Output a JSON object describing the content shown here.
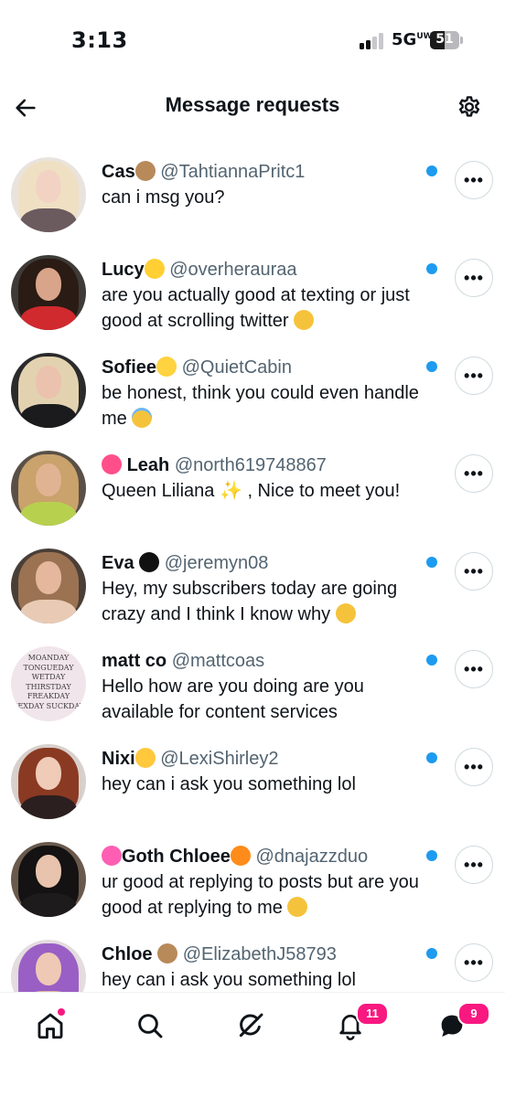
{
  "status_bar": {
    "time": "3:13",
    "network": "5G",
    "network_sup": "UW",
    "battery_level": "51",
    "battery_fraction": 0.51
  },
  "header": {
    "title": "Message requests"
  },
  "colors": {
    "accent": "#1d9bf0",
    "badge": "#f91880",
    "handle": "#536471",
    "text": "#0f1419",
    "border": "#cfd9de"
  },
  "requests": [
    {
      "display_name": "Cas",
      "name_emoji_after": "see-no-evil-monkey",
      "handle": "@TahtiannaPritc1",
      "message": "can i msg you?",
      "unread": true
    },
    {
      "display_name": "Lucy",
      "name_emoji_after": "hatching-chick",
      "handle": "@overherauraa",
      "message": "are you actually good at texting or just good at scrolling twitter",
      "message_emoji": "loudly-crying-face",
      "unread": true
    },
    {
      "display_name": "Sofiee",
      "name_emoji_after": "dizzy",
      "handle": "@QuietCabin",
      "message": "be honest, think you could even handle me",
      "message_emoji": "smiling-face-with-halo",
      "unread": true
    },
    {
      "display_name": "Leah",
      "name_emoji_before": "heart-with-arrow",
      "handle": "@north619748867",
      "message": "Queen Liliana ✨ ,  Nice to meet you!",
      "unread": false
    },
    {
      "display_name": "Eva",
      "name_emoji_after": "black-heart",
      "handle": "@jeremyn08",
      "message": "Hey, my subscribers today are going crazy and I think I know why",
      "message_emoji": "grinning-face-with-sweat",
      "unread": true
    },
    {
      "display_name": "matt co",
      "handle": "@mattcoas",
      "message": "Hello how are you doing are you available for content services",
      "avatar_text": "MOANDAY TONGUEDAY WETDAY THIRSTDAY FREAKDAY SEXDAY SUCKDAY",
      "unread": true
    },
    {
      "display_name": "Nixi",
      "name_emoji_after": "yellow-heart",
      "handle": "@LexiShirley2",
      "message": "hey can i ask you something lol",
      "unread": true
    },
    {
      "display_name": "Goth Chloee",
      "name_emoji_before": "pink-heart",
      "name_emoji_after": "orange-heart",
      "handle": "@dnajazzduo",
      "message": "ur good at replying to posts but are you good at replying to me",
      "message_emoji": "grinning-squinting-face",
      "unread": true
    },
    {
      "display_name": "Chloe",
      "name_emoji_after": "see-no-evil-monkey",
      "handle": "@ElizabethJ58793",
      "message": "hey can i ask you something lol",
      "unread": true
    }
  ],
  "more_label": "•••",
  "tab_bar": {
    "tabs": [
      {
        "name": "home-icon",
        "has_dot": true
      },
      {
        "name": "search-icon"
      },
      {
        "name": "grok-icon"
      },
      {
        "name": "notifications-icon",
        "badge": "11"
      },
      {
        "name": "messages-icon",
        "badge": "9"
      }
    ]
  }
}
